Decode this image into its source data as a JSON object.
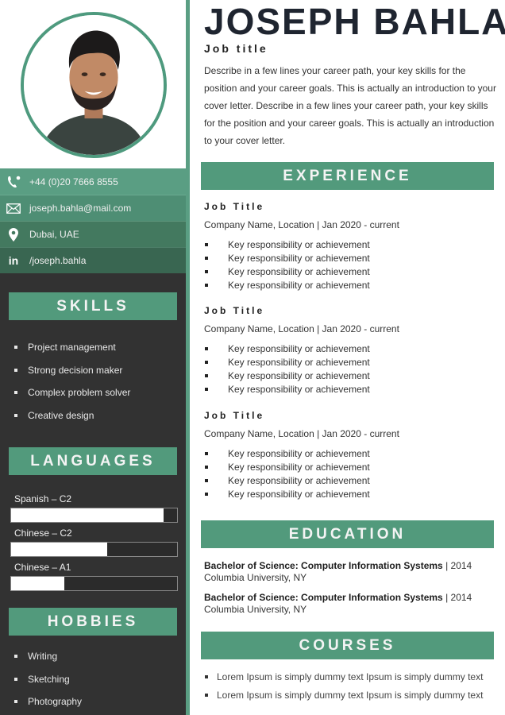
{
  "profile": {
    "name": "JOSEPH BAHLA",
    "job_title": "Job title",
    "intro": "Describe in a few lines your career path, your key skills for the position and your career goals. This is actually an introduction to your cover letter. Describe in a few lines your career path, your key skills for the position and your career goals. This is actually an introduction to your cover letter."
  },
  "contact": [
    {
      "icon": "phone-icon",
      "text": "+44 (0)20 7666 8555"
    },
    {
      "icon": "envelope-icon",
      "text": "joseph.bahla@mail.com"
    },
    {
      "icon": "location-pin-icon",
      "text": "Dubai, UAE"
    },
    {
      "icon": "linkedin-icon",
      "text": "/joseph.bahla"
    }
  ],
  "skills": {
    "heading": "SKILLS",
    "items": [
      "Project management",
      "Strong decision maker",
      "Complex problem solver",
      "Creative design"
    ]
  },
  "languages": {
    "heading": "LANGUAGES",
    "items": [
      {
        "label": "Spanish – C2",
        "level": 0.92
      },
      {
        "label": "Chinese – C2",
        "level": 0.58
      },
      {
        "label": "Chinese – A1",
        "level": 0.32
      }
    ]
  },
  "hobbies": {
    "heading": "HOBBIES",
    "items": [
      "Writing",
      "Sketching",
      "Photography"
    ]
  },
  "experience": {
    "heading": "EXPERIENCE",
    "jobs": [
      {
        "title": "Job Title",
        "company": "Company Name, Location | Jan 2020 - current",
        "bullets": [
          "Key responsibility or achievement",
          "Key responsibility or achievement",
          "Key responsibility or achievement",
          "Key responsibility or achievement"
        ]
      },
      {
        "title": "Job Title",
        "company": "Company Name, Location | Jan 2020 - current",
        "bullets": [
          "Key responsibility or achievement",
          "Key responsibility or achievement",
          "Key responsibility or achievement",
          "Key responsibility or achievement"
        ]
      },
      {
        "title": "Job Title",
        "company": "Company Name, Location | Jan 2020 - current",
        "bullets": [
          "Key responsibility or achievement",
          "Key responsibility or achievement",
          "Key responsibility or achievement",
          "Key responsibility or achievement"
        ]
      }
    ]
  },
  "education": {
    "heading": "EDUCATION",
    "items": [
      {
        "degree": "Bachelor of Science: Computer Information Systems",
        "year": "| 2014",
        "school": "Columbia University, NY"
      },
      {
        "degree": "Bachelor of Science: Computer Information Systems",
        "year": "| 2014",
        "school": "Columbia University, NY"
      }
    ]
  },
  "courses": {
    "heading": "COURSES",
    "items": [
      "Lorem Ipsum is simply dummy text Ipsum is simply dummy text",
      "Lorem Ipsum is simply dummy text Ipsum is simply dummy text"
    ]
  },
  "colors": {
    "accent_green": "#529a7c",
    "sidebar_dark": "#323232",
    "name_dark": "#1f2530"
  }
}
